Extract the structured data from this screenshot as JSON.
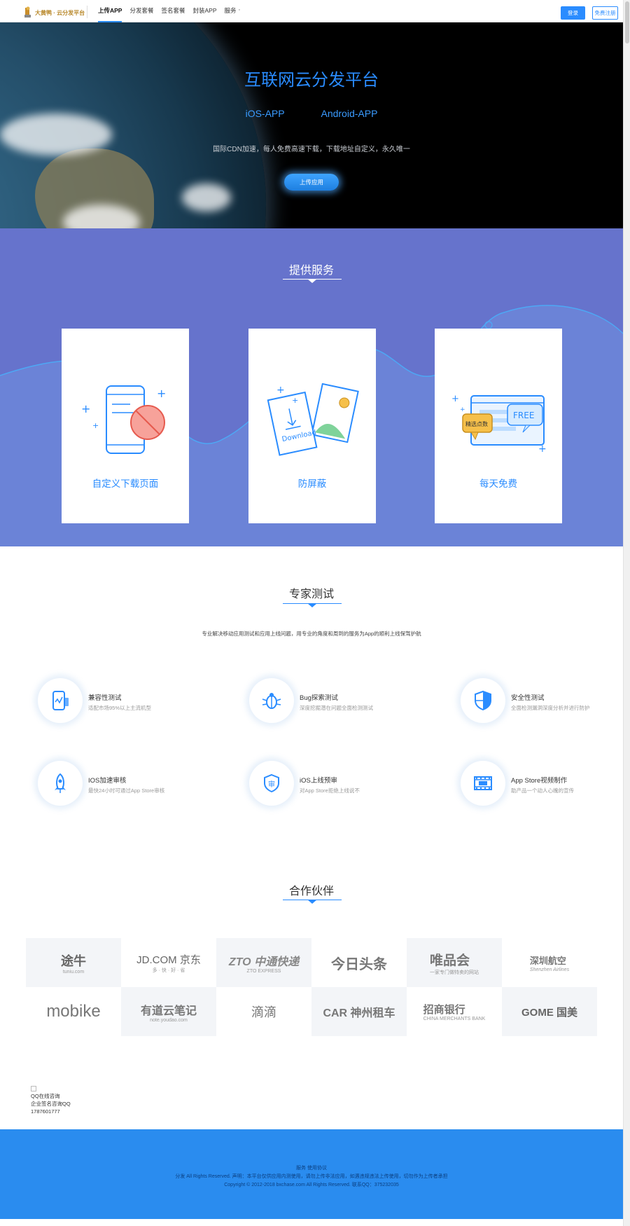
{
  "header": {
    "logo_text": "大黄鸭 · 云分发平台",
    "nav": [
      "上传APP",
      "分发套餐",
      "签名套餐",
      "封装APP",
      "服务"
    ],
    "login": "登录",
    "register": "免费注册"
  },
  "hero": {
    "title": "互联网云分发平台",
    "links": [
      "iOS-APP",
      "Android-APP"
    ],
    "desc": "国际CDN加速，每人免费高速下载，下载地址自定义，永久唯一",
    "button": "上传应用"
  },
  "services": {
    "title": "提供服务",
    "cards": [
      {
        "label": "自定义下载页面",
        "icon": "phone-block-icon"
      },
      {
        "label": "防屏蔽",
        "icon": "download-cards-icon"
      },
      {
        "label": "每天免费",
        "icon": "free-chat-icon",
        "badge_free": "FREE",
        "badge_pick": "精选点数"
      }
    ]
  },
  "expert": {
    "title": "专家测试",
    "desc": "专业解决移动应用测试和应用上线问题，用专业的角度和周到的服务为App的顺利上线保驾护航",
    "items": [
      {
        "title": "兼容性测试",
        "desc": "适配市场95%以上主流机型",
        "icon": "phone-chart-icon"
      },
      {
        "title": "Bug探索测试",
        "desc": "深度挖掘潜在问题全面检测测试",
        "icon": "bug-icon"
      },
      {
        "title": "安全性测试",
        "desc": "全面检测漏洞深度分析并进行防护",
        "icon": "shield-icon"
      },
      {
        "title": "IOS加速审核",
        "desc": "最快24小时可通过App Store审核",
        "icon": "rocket-icon"
      },
      {
        "title": "iOS上线预审",
        "desc": "对App Store拒绝上线说不",
        "icon": "audit-shield-icon"
      },
      {
        "title": "App Store视频制作",
        "desc": "助产品一个动人心魄的宣传",
        "icon": "film-icon"
      }
    ]
  },
  "partners": {
    "title": "合作伙伴",
    "items": [
      {
        "name": "途牛",
        "sub": "tuniu.com"
      },
      {
        "name": "JD.COM 京东",
        "sub": "多 · 快 · 好 · 省"
      },
      {
        "name": "ZTO 中通快递",
        "sub": "ZTO EXPRESS"
      },
      {
        "name": "今日头条",
        "sub": ""
      },
      {
        "name": "唯品会",
        "sub": "一家专门做特卖的网站"
      },
      {
        "name": "深圳航空",
        "sub": "Shenzhen Airlines"
      },
      {
        "name": "mobike",
        "sub": ""
      },
      {
        "name": "有道云笔记",
        "sub": "note.youdao.com"
      },
      {
        "name": "滴滴",
        "sub": ""
      },
      {
        "name": "CAR 神州租车",
        "sub": ""
      },
      {
        "name": "招商银行",
        "sub": "CHINA MERCHANTS BANK"
      },
      {
        "name": "GOME 国美",
        "sub": ""
      }
    ]
  },
  "qq": {
    "lines": [
      "QQ在线咨询",
      "企业签名咨询QQ",
      "1787601777"
    ]
  },
  "footer": {
    "lines": [
      "服务 使用协议",
      "分发 All Rights Reserved. 声明：本平台仅供应用内测使用，请勿上传非法应用，如遇违规违法上传使用，切勿作为上传者承担",
      "Copyright © 2012-2018 bxchase.com All Rights Reserved. 联系QQ：375232035"
    ]
  }
}
